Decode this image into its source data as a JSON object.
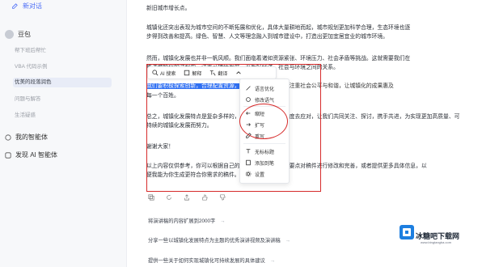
{
  "sidebar": {
    "new_chat": "新对话",
    "section_assistant": "豆包",
    "items": [
      "帮下班后帮忙",
      "VBA 代码示例",
      "优美的段落润色",
      "问题与解答",
      "生活疑惑"
    ],
    "active_index": 2,
    "my_agents": "我的智能体",
    "discover": "发现 AI 智能体"
  },
  "main": {
    "top_line": "新旧城市增长点。",
    "para1_l1": "城镇化还突出表现为城市空间的不断拓展和优化，具体大量耕地而起，城市规划更加科学合理，生态环境也逐",
    "para1_l2": "步得到改善和提高。绿色、智慧、人文等理念融入到城市建设中，打造出更加宜居宜业的城市环境。",
    "para2_l1": "然而，城镇化发展也并非一帆风顺。我们面临着诸如资源紧张、环境压力、社会矛盾等挑战。这就需要我们在",
    "para2_l2": "推进城镇化的过程中，注重可持续发展，平衡好经济、社会与环境之间的关系。",
    "hl_l1": "我们要积极探索创新，合理配置资源，推动城乡融合发展",
    "hl_l1_rest": "，注重社会公平与和谐，让城镇化的成果惠及",
    "hl_l2": "每一个百姓。",
    "para3_l1": "总之，城镇化发展特点是复杂多样的，我们需要以积极的态度去应对，让我们共同关注、探讨，携手共进，为实现更加高质量、可",
    "para3_l2": "持续的城镇化发展而努力。",
    "thanks": "谢谢大家！",
    "closing_l1": "以上内容仅供参考，你可以根据自己的实际情况和具体讨论要点对稿件进行修改和完善，或者提供更多具体信息，以",
    "closing_l2": "便我能为你生成更符合你需求的稿件。"
  },
  "toolbar": {
    "ask_ai": "AI 搜索",
    "explain": "解释",
    "translate": "翻译",
    "more_chevron": "更多"
  },
  "dropdown": {
    "items": [
      "语言优化",
      "修改语气",
      "缩短",
      "扩写",
      "重写",
      "无标标题",
      "添加到笔",
      "设置"
    ]
  },
  "suggestions": [
    "将演讲稿的内容扩展到2000字",
    "分享一些以城镇化发展特点为主题的优秀演讲视频及演讲稿",
    "提供一些关于如何实现城镇化可持续发展的具体建议"
  ],
  "watermark": {
    "name": "冰糖吧下载网",
    "sub": "www.bingtangba.com"
  }
}
